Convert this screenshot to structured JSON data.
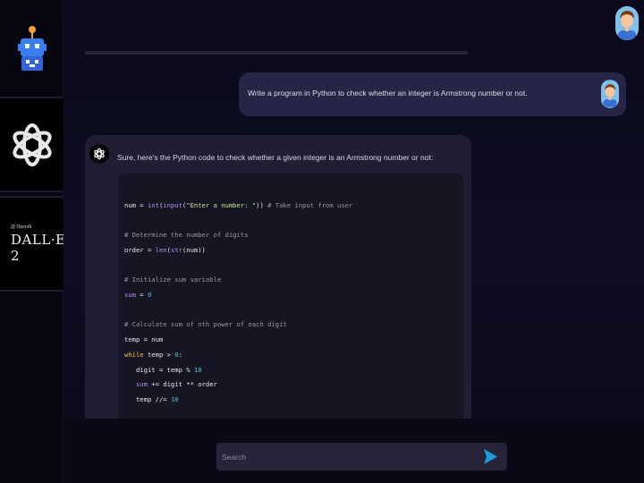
{
  "sidebar": {
    "logo_icon": "robot-icon",
    "tiles": [
      {
        "icon": "openai-logo-icon"
      },
      {
        "label_small": "@ OpenAI",
        "label_big": "DALL·E 2"
      }
    ]
  },
  "user_message": {
    "text": "Write a program in Python to check whether an integer is Armstrong number or not."
  },
  "bot_message": {
    "intro": "Sure, here's the Python code to check whether a given integer is an Armstrong number or not:"
  },
  "search": {
    "placeholder": "Search",
    "value": ""
  },
  "colors": {
    "accent_send": "#1e9be0",
    "user_bubble": "#262546",
    "bot_bubble": "#1f1e32"
  }
}
